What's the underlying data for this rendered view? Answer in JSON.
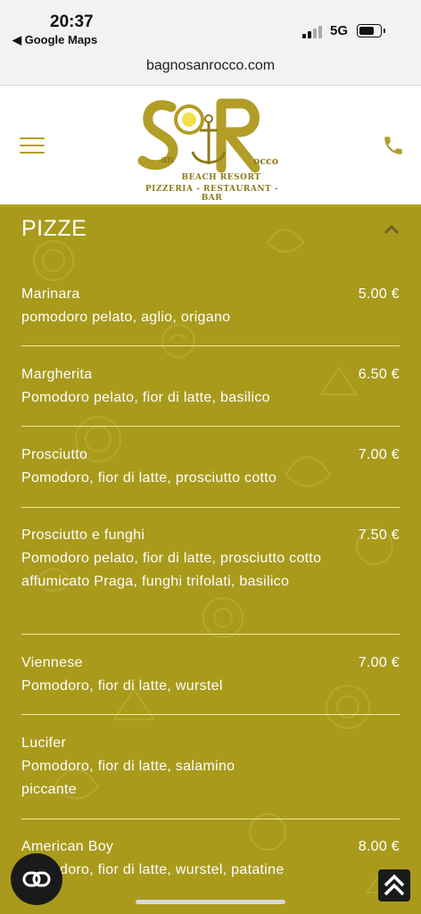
{
  "status": {
    "time": "20:37",
    "back_label": "◀ Google Maps",
    "network": "5G"
  },
  "browser": {
    "url": "bagnosanrocco.com"
  },
  "header": {
    "logo_icon": "san-rocco-anchor-logo",
    "logo_line1": "BEACH RESORT",
    "logo_line2": "PIZZERIA - RESTAURANT - BAR",
    "logo_left_text": "an",
    "logo_right_text": "occo",
    "menu_icon": "hamburger-icon",
    "phone_icon": "phone-icon"
  },
  "section": {
    "title": "PIZZE",
    "collapse_icon": "chevron-up-icon"
  },
  "menu_items": [
    {
      "name": "Marinara",
      "price": "5.00  €",
      "description": "pomodoro pelato, aglio, origano"
    },
    {
      "name": "Margherita",
      "price": "6.50  €",
      "description": "Pomodoro pelato, fior di latte, basilico"
    },
    {
      "name": "Prosciutto",
      "price": "7.00  €",
      "description": "Pomodoro, fior di latte, prosciutto cotto"
    },
    {
      "name": "Prosciutto e funghi",
      "price": "7.50  €",
      "description": "Pomodoro pelato, fior di latte, prosciutto cotto affumicato Praga, funghi trifolati, basilico"
    },
    {
      "name": "Viennese",
      "price": "7.00  €",
      "description": "Pomodoro, fior di latte, wurstel"
    },
    {
      "name": "Lucifer",
      "price": "",
      "description": "Pomodoro, fior di latte, salamino piccante"
    },
    {
      "name": "American Boy",
      "price": "8.00  €",
      "description": "Pomodoro, fior di latte, wurstel, patatine"
    }
  ],
  "floating": {
    "left_icon": "link-icon",
    "right_icon": "scroll-to-top-icon"
  },
  "colors": {
    "accent": "#a99a1c",
    "logo": "#b29d27",
    "divider": "#f2ea9a"
  }
}
